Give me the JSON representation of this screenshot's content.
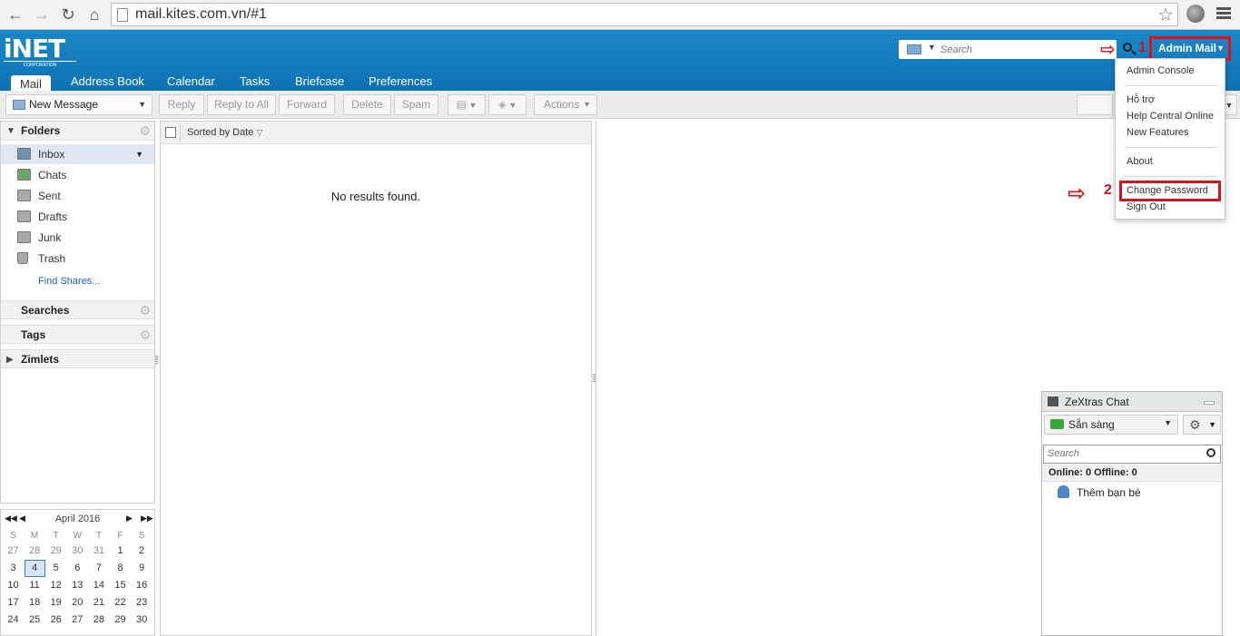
{
  "browser": {
    "url": "mail.kites.com.vn/#1",
    "back_icon": "arrow-left-icon",
    "forward_icon": "arrow-right-icon",
    "reload_icon": "reload-icon",
    "home_icon": "home-icon"
  },
  "header": {
    "logo_text": "iNET",
    "logo_sub": "CORPORATION",
    "search_placeholder": "Search",
    "user_button": "Admin Mail",
    "annotation_1": "1",
    "annotation_2": "2",
    "brand_color": "#1283c4",
    "annotation_color": "#e0101a"
  },
  "app_tabs": [
    "Mail",
    "Address Book",
    "Calendar",
    "Tasks",
    "Briefcase",
    "Preferences"
  ],
  "toolbar": {
    "new_message": "New Message",
    "reply": "Reply",
    "reply_all": "Reply to All",
    "forward": "Forward",
    "delete": "Delete",
    "spam": "Spam",
    "actions": "Actions"
  },
  "folders_panel": {
    "header": "Folders",
    "items": [
      "Inbox",
      "Chats",
      "Sent",
      "Drafts",
      "Junk",
      "Trash"
    ],
    "find_shares": "Find Shares...",
    "searches": "Searches",
    "tags": "Tags",
    "zimlets": "Zimlets"
  },
  "mini_calendar": {
    "month": "April 2016",
    "dow": [
      "S",
      "M",
      "T",
      "W",
      "T",
      "F",
      "S"
    ],
    "weeks": [
      [
        "27",
        "28",
        "29",
        "30",
        "31",
        "1",
        "2"
      ],
      [
        "3",
        "4",
        "5",
        "6",
        "7",
        "8",
        "9"
      ],
      [
        "10",
        "11",
        "12",
        "13",
        "14",
        "15",
        "16"
      ],
      [
        "17",
        "18",
        "19",
        "20",
        "21",
        "22",
        "23"
      ],
      [
        "24",
        "25",
        "26",
        "27",
        "28",
        "29",
        "30"
      ]
    ],
    "today": "4"
  },
  "message_list": {
    "sort_label": "Sorted by Date",
    "empty_text": "No results found."
  },
  "user_menu": {
    "items": [
      "Admin Console",
      "Hỗ trợ",
      "Help Central Online",
      "New Features",
      "About",
      "Change Password",
      "Sign Out"
    ]
  },
  "chat": {
    "title": "ZeXtras Chat",
    "status": "Sẵn sàng",
    "search_placeholder": "Search",
    "online_summary": "Online: 0 Offline: 0",
    "add_friends": "Thêm bạn bè"
  }
}
